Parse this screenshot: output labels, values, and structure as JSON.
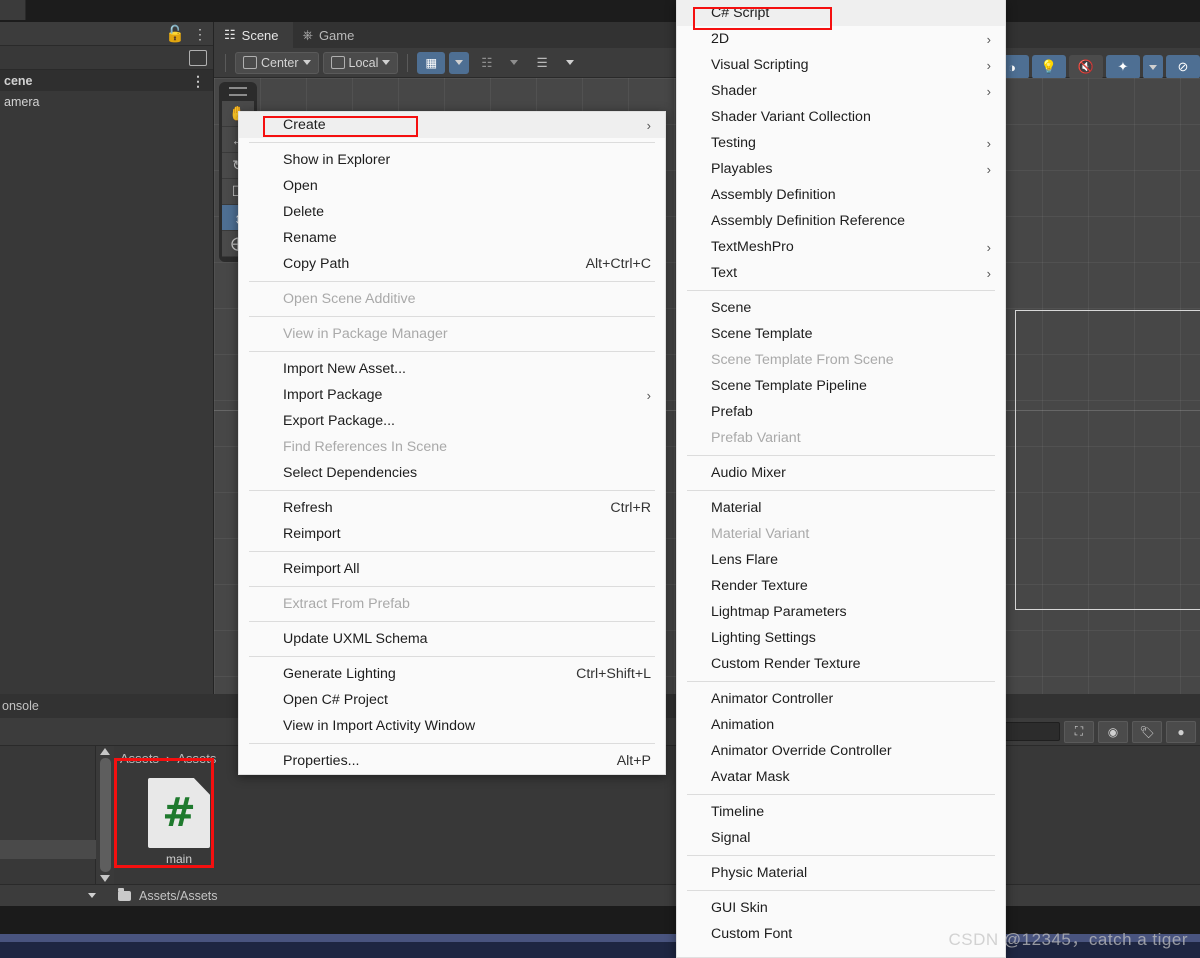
{
  "window": {
    "hierarchy": {
      "rows": [
        {
          "label": "cene",
          "kind": "scene"
        },
        {
          "label": "amera",
          "kind": "object"
        }
      ]
    },
    "scene_view": {
      "tabs": [
        {
          "label": "Scene",
          "icon": "grid-icon",
          "active": true
        },
        {
          "label": "Game",
          "icon": "gamepad-icon",
          "active": false
        }
      ],
      "toolbar": {
        "pivot_label": "Center",
        "space_label": "Local",
        "grid_snap_icon": "grid-snap-icon",
        "magnet_icon": "magnet-snap-icon",
        "ruler_icon": "ruler-icon"
      },
      "tool_palette": [
        {
          "name": "hand-tool",
          "glyph": "✋",
          "active": false
        },
        {
          "name": "move-tool",
          "glyph": "↔",
          "active": false
        },
        {
          "name": "rotate-tool",
          "glyph": "↻",
          "active": false
        },
        {
          "name": "scale-tool",
          "glyph": "□",
          "active": false
        },
        {
          "name": "rect-tool",
          "glyph": "↕",
          "active": true
        },
        {
          "name": "transform-tool",
          "glyph": "⊕",
          "active": false
        }
      ],
      "right_toolbar": [
        {
          "name": "audio-button",
          "glyph": "◑",
          "style": "blue"
        },
        {
          "name": "lighting-button",
          "glyph": "Ὂ1",
          "style": "blue"
        },
        {
          "name": "mute-audio-button",
          "glyph": "ὐ7",
          "style": "grey"
        },
        {
          "name": "effects-button",
          "glyph": "✦",
          "style": "blue"
        },
        {
          "name": "effects-dropdown",
          "glyph": "▼",
          "style": "blue-sm"
        },
        {
          "name": "scene-visibility-button",
          "glyph": "⊘",
          "style": "blue"
        }
      ]
    },
    "console": {
      "tab_label": "onsole"
    },
    "project": {
      "breadcrumb": [
        "Assets",
        "Assets"
      ],
      "breadcrumb_sep": "›",
      "asset": {
        "label": "main",
        "icon": "csharp-script-icon",
        "glyph": "#"
      },
      "footer_path": "Assets/Assets"
    }
  },
  "context_menu": {
    "name": "project-context-menu",
    "items": [
      {
        "label": "Create",
        "submenu": true,
        "highlighted": true,
        "annotated": true
      },
      {
        "type": "separator"
      },
      {
        "label": "Show in Explorer"
      },
      {
        "label": "Open"
      },
      {
        "label": "Delete"
      },
      {
        "label": "Rename"
      },
      {
        "label": "Copy Path",
        "shortcut": "Alt+Ctrl+C"
      },
      {
        "type": "separator"
      },
      {
        "label": "Open Scene Additive",
        "disabled": true
      },
      {
        "type": "separator"
      },
      {
        "label": "View in Package Manager",
        "disabled": true
      },
      {
        "type": "separator"
      },
      {
        "label": "Import New Asset..."
      },
      {
        "label": "Import Package",
        "submenu": true
      },
      {
        "label": "Export Package..."
      },
      {
        "label": "Find References In Scene",
        "disabled": true
      },
      {
        "label": "Select Dependencies"
      },
      {
        "type": "separator"
      },
      {
        "label": "Refresh",
        "shortcut": "Ctrl+R"
      },
      {
        "label": "Reimport"
      },
      {
        "type": "separator"
      },
      {
        "label": "Reimport All"
      },
      {
        "type": "separator"
      },
      {
        "label": "Extract From Prefab",
        "disabled": true
      },
      {
        "type": "separator"
      },
      {
        "label": "Update UXML Schema"
      },
      {
        "type": "separator"
      },
      {
        "label": "Generate Lighting",
        "shortcut": "Ctrl+Shift+L"
      },
      {
        "label": "Open C# Project"
      },
      {
        "label": "View in Import Activity Window"
      },
      {
        "type": "separator"
      },
      {
        "label": "Properties...",
        "shortcut": "Alt+P"
      }
    ]
  },
  "create_submenu": {
    "name": "create-submenu",
    "items": [
      {
        "label": "C# Script",
        "highlighted": true,
        "annotated": true
      },
      {
        "label": "2D",
        "submenu": true
      },
      {
        "label": "Visual Scripting",
        "submenu": true
      },
      {
        "label": "Shader",
        "submenu": true
      },
      {
        "label": "Shader Variant Collection"
      },
      {
        "label": "Testing",
        "submenu": true
      },
      {
        "label": "Playables",
        "submenu": true
      },
      {
        "label": "Assembly Definition"
      },
      {
        "label": "Assembly Definition Reference"
      },
      {
        "label": "TextMeshPro",
        "submenu": true
      },
      {
        "label": "Text",
        "submenu": true
      },
      {
        "type": "separator"
      },
      {
        "label": "Scene"
      },
      {
        "label": "Scene Template"
      },
      {
        "label": "Scene Template From Scene",
        "disabled": true
      },
      {
        "label": "Scene Template Pipeline"
      },
      {
        "label": "Prefab"
      },
      {
        "label": "Prefab Variant",
        "disabled": true
      },
      {
        "type": "separator"
      },
      {
        "label": "Audio Mixer"
      },
      {
        "type": "separator"
      },
      {
        "label": "Material"
      },
      {
        "label": "Material Variant",
        "disabled": true
      },
      {
        "label": "Lens Flare"
      },
      {
        "label": "Render Texture"
      },
      {
        "label": "Lightmap Parameters"
      },
      {
        "label": "Lighting Settings"
      },
      {
        "label": "Custom Render Texture"
      },
      {
        "type": "separator"
      },
      {
        "label": "Animator Controller"
      },
      {
        "label": "Animation"
      },
      {
        "label": "Animator Override Controller"
      },
      {
        "label": "Avatar Mask"
      },
      {
        "type": "separator"
      },
      {
        "label": "Timeline"
      },
      {
        "label": "Signal"
      },
      {
        "type": "separator"
      },
      {
        "label": "Physic Material"
      },
      {
        "type": "separator"
      },
      {
        "label": "GUI Skin"
      },
      {
        "label": "Custom Font"
      }
    ]
  },
  "watermark": {
    "text": "CSDN @12345，catch a tiger"
  },
  "colors": {
    "annotation_red": "#f50f0f",
    "menu_background": "#fafafa",
    "accent_blue": "#4e6f93",
    "csharp_green": "#1f7a2e"
  }
}
